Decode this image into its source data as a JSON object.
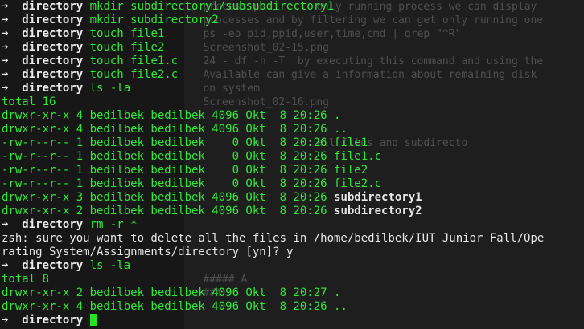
{
  "background_doc": {
    "lines": [
      "   process ps        only running process we can display",
      "   processes and by filtering we can get only running one",
      "   ps -eo pid,ppid,user,time,cmd | grep \"^R\"",
      "   Screenshot_02-15.png",
      "   24 - df -h -T  by executing this command and using the",
      "   Available can give a information about remaining disk",
      "   on system",
      "   Screenshot_02-16.png",
      "",
      "",
      "           b         all files and subdirecto",
      "",
      "",
      "",
      "",
      "",
      "",
      "",
      "",
      "",
      "   ##### A",
      "   ###",
      "",
      "",
      ""
    ]
  },
  "prompt": {
    "arrow": "➜",
    "cwd": "directory"
  },
  "session": [
    {
      "type": "cmd",
      "text": "mkdir subdirectory1/subsubdirectory1"
    },
    {
      "type": "cmd",
      "text": "mkdir subdirectory2"
    },
    {
      "type": "cmd",
      "text": "touch file1"
    },
    {
      "type": "cmd",
      "text": "touch file2"
    },
    {
      "type": "cmd",
      "text": "touch file1.c"
    },
    {
      "type": "cmd",
      "text": "touch file2.c"
    },
    {
      "type": "cmd",
      "text": "ls -la"
    },
    {
      "type": "out",
      "text": "total 16"
    },
    {
      "type": "ls",
      "prefix": "drwxr-xr-x 4 bedilbek bedilbek 4096 Okt  8 20:26 ",
      "name": ".",
      "is_dir": false
    },
    {
      "type": "ls",
      "prefix": "drwxr-xr-x 4 bedilbek bedilbek 4096 Okt  8 20:26 ",
      "name": "..",
      "is_dir": false
    },
    {
      "type": "ls",
      "prefix": "-rw-r--r-- 1 bedilbek bedilbek    0 Okt  8 20:26 ",
      "name": "file1",
      "is_dir": false
    },
    {
      "type": "ls",
      "prefix": "-rw-r--r-- 1 bedilbek bedilbek    0 Okt  8 20:26 ",
      "name": "file1.c",
      "is_dir": false
    },
    {
      "type": "ls",
      "prefix": "-rw-r--r-- 1 bedilbek bedilbek    0 Okt  8 20:26 ",
      "name": "file2",
      "is_dir": false
    },
    {
      "type": "ls",
      "prefix": "-rw-r--r-- 1 bedilbek bedilbek    0 Okt  8 20:26 ",
      "name": "file2.c",
      "is_dir": false
    },
    {
      "type": "ls",
      "prefix": "drwxr-xr-x 3 bedilbek bedilbek 4096 Okt  8 20:26 ",
      "name": "subdirectory1",
      "is_dir": true
    },
    {
      "type": "ls",
      "prefix": "drwxr-xr-x 2 bedilbek bedilbek 4096 Okt  8 20:26 ",
      "name": "subdirectory2",
      "is_dir": true
    },
    {
      "type": "cmd",
      "text": "rm -r *"
    },
    {
      "type": "warn",
      "text": "zsh: sure you want to delete all the files in /home/bedilbek/IUT Junior Fall/Ope"
    },
    {
      "type": "warn_tail",
      "text": "rating System/Assignments/directory [yn]? ",
      "answer": "y"
    },
    {
      "type": "cmd",
      "text": "ls -la"
    },
    {
      "type": "out",
      "text": "total 8"
    },
    {
      "type": "ls",
      "prefix": "drwxr-xr-x 2 bedilbek bedilbek 4096 Okt  8 20:27 ",
      "name": ".",
      "is_dir": false
    },
    {
      "type": "ls",
      "prefix": "drwxr-xr-x 4 bedilbek bedilbek 4096 Okt  8 20:26 ",
      "name": "..",
      "is_dir": false
    },
    {
      "type": "prompt_active",
      "text": ""
    }
  ],
  "colors": {
    "background": "#171717",
    "green": "#31e839",
    "white": "#e8e8e8",
    "cursor": "#1fe61f"
  }
}
